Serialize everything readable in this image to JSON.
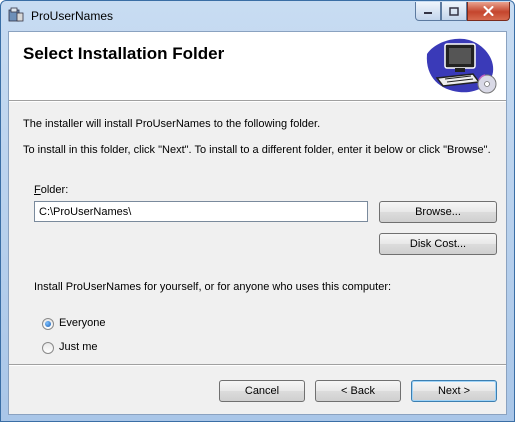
{
  "window": {
    "title": "ProUserNames",
    "controls": {
      "minimize": "minimize",
      "maximize": "maximize",
      "close": "close"
    }
  },
  "banner": {
    "title": "Select Installation Folder"
  },
  "content": {
    "intro": "The installer will install ProUserNames to the following folder.",
    "instructions": "To install in this folder, click \"Next\". To install to a different folder, enter it below or click \"Browse\".",
    "folder_label_mnemonic": "F",
    "folder_label_rest": "older:",
    "folder_value": "C:\\ProUserNames\\",
    "browse_label": "Browse...",
    "disk_cost_label": "Disk Cost...",
    "scope_question": "Install ProUserNames for yourself, or for anyone who uses this computer:",
    "scope_options": [
      {
        "label": "Everyone",
        "selected": true
      },
      {
        "label": "Just me",
        "selected": false
      }
    ]
  },
  "footer": {
    "cancel_label": "Cancel",
    "back_label": "< Back",
    "next_label": "Next >"
  },
  "colors": {
    "titlebar": "#b9d1ee",
    "close_button": "#c4452d",
    "dialog_bg": "#f0f0f0",
    "default_button_border": "#3c7fb1"
  }
}
